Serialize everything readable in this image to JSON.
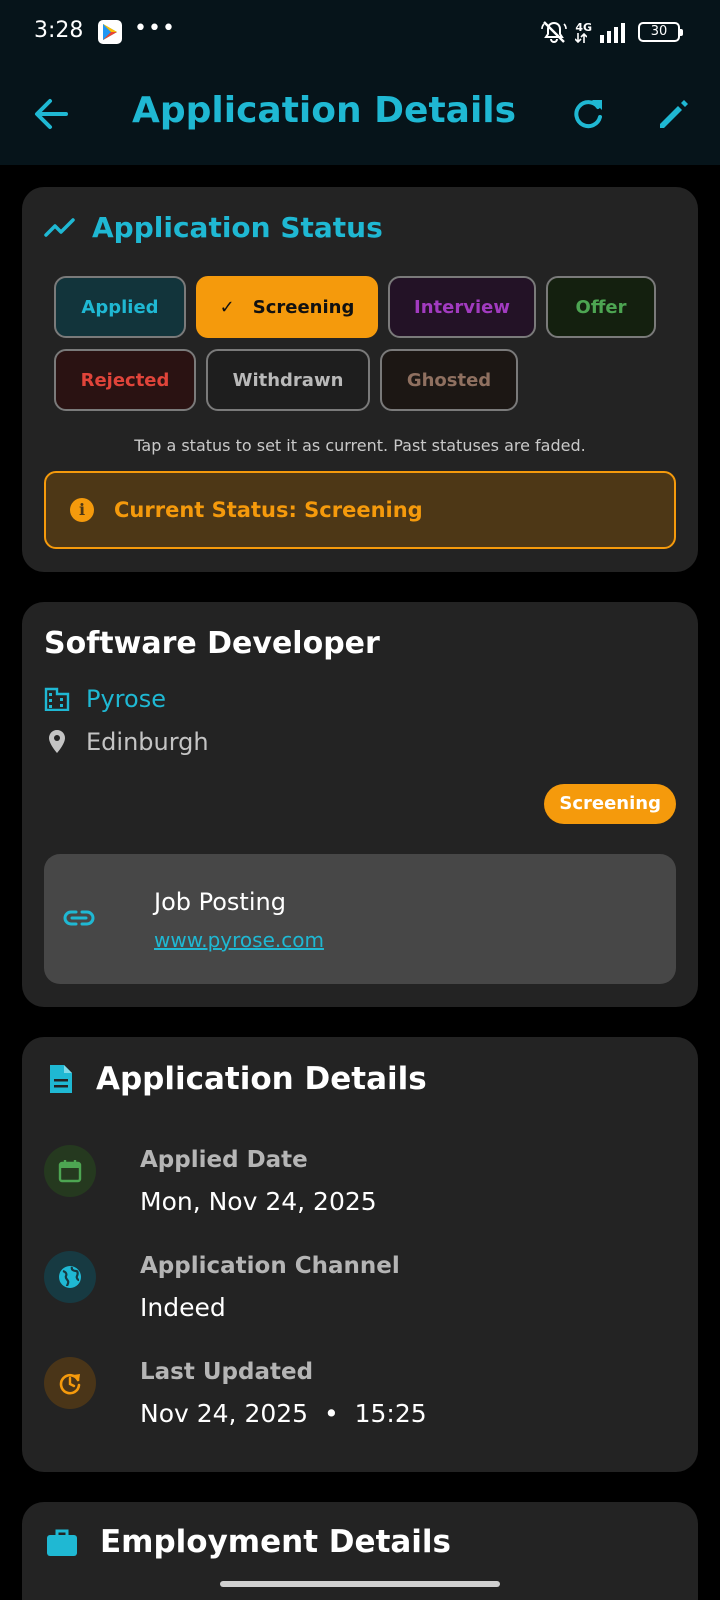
{
  "status_bar": {
    "time": "3:28",
    "network": "4G",
    "battery": "30"
  },
  "app_bar": {
    "title": "Application Details"
  },
  "status_card": {
    "title": "Application Status",
    "chips": [
      {
        "label": "Applied",
        "color": "#1fb8d3",
        "bg": "#12343b"
      },
      {
        "label": "Screening",
        "color": "#111111",
        "bg": "#f59a0c",
        "selected": true
      },
      {
        "label": "Interview",
        "color": "#a23bc0",
        "bg": "#231226"
      },
      {
        "label": "Offer",
        "color": "#4da552",
        "bg": "#14200f"
      },
      {
        "label": "Rejected",
        "color": "#e0443a",
        "bg": "#2a1212"
      },
      {
        "label": "Withdrawn",
        "color": "#b9b9b9",
        "bg": "#1e1e1e"
      },
      {
        "label": "Ghosted",
        "color": "#8f7060",
        "bg": "#1c1714"
      }
    ],
    "hint": "Tap a status to set it as current. Past statuses are faded.",
    "current_status": "Current Status: Screening"
  },
  "job_card": {
    "title": "Software Developer",
    "company": "Pyrose",
    "location": "Edinburgh",
    "status_badge": "Screening",
    "link_label": "Job Posting",
    "link_url": "www.pyrose.com"
  },
  "details_card": {
    "title": "Application Details",
    "rows": [
      {
        "label": "Applied Date",
        "value": "Mon, Nov 24, 2025",
        "icon": "calendar-icon",
        "color": "#4da552"
      },
      {
        "label": "Application Channel",
        "value": "Indeed",
        "icon": "globe-icon",
        "color": "#1fb8d3"
      },
      {
        "label": "Last Updated",
        "value": "Nov 24, 2025  •  15:25",
        "icon": "update-icon",
        "color": "#f59a0c"
      }
    ]
  },
  "employment_card": {
    "title": "Employment Details"
  },
  "colors": {
    "accent": "#1fb8d3",
    "warning": "#f59a0c",
    "card": "#232323"
  }
}
